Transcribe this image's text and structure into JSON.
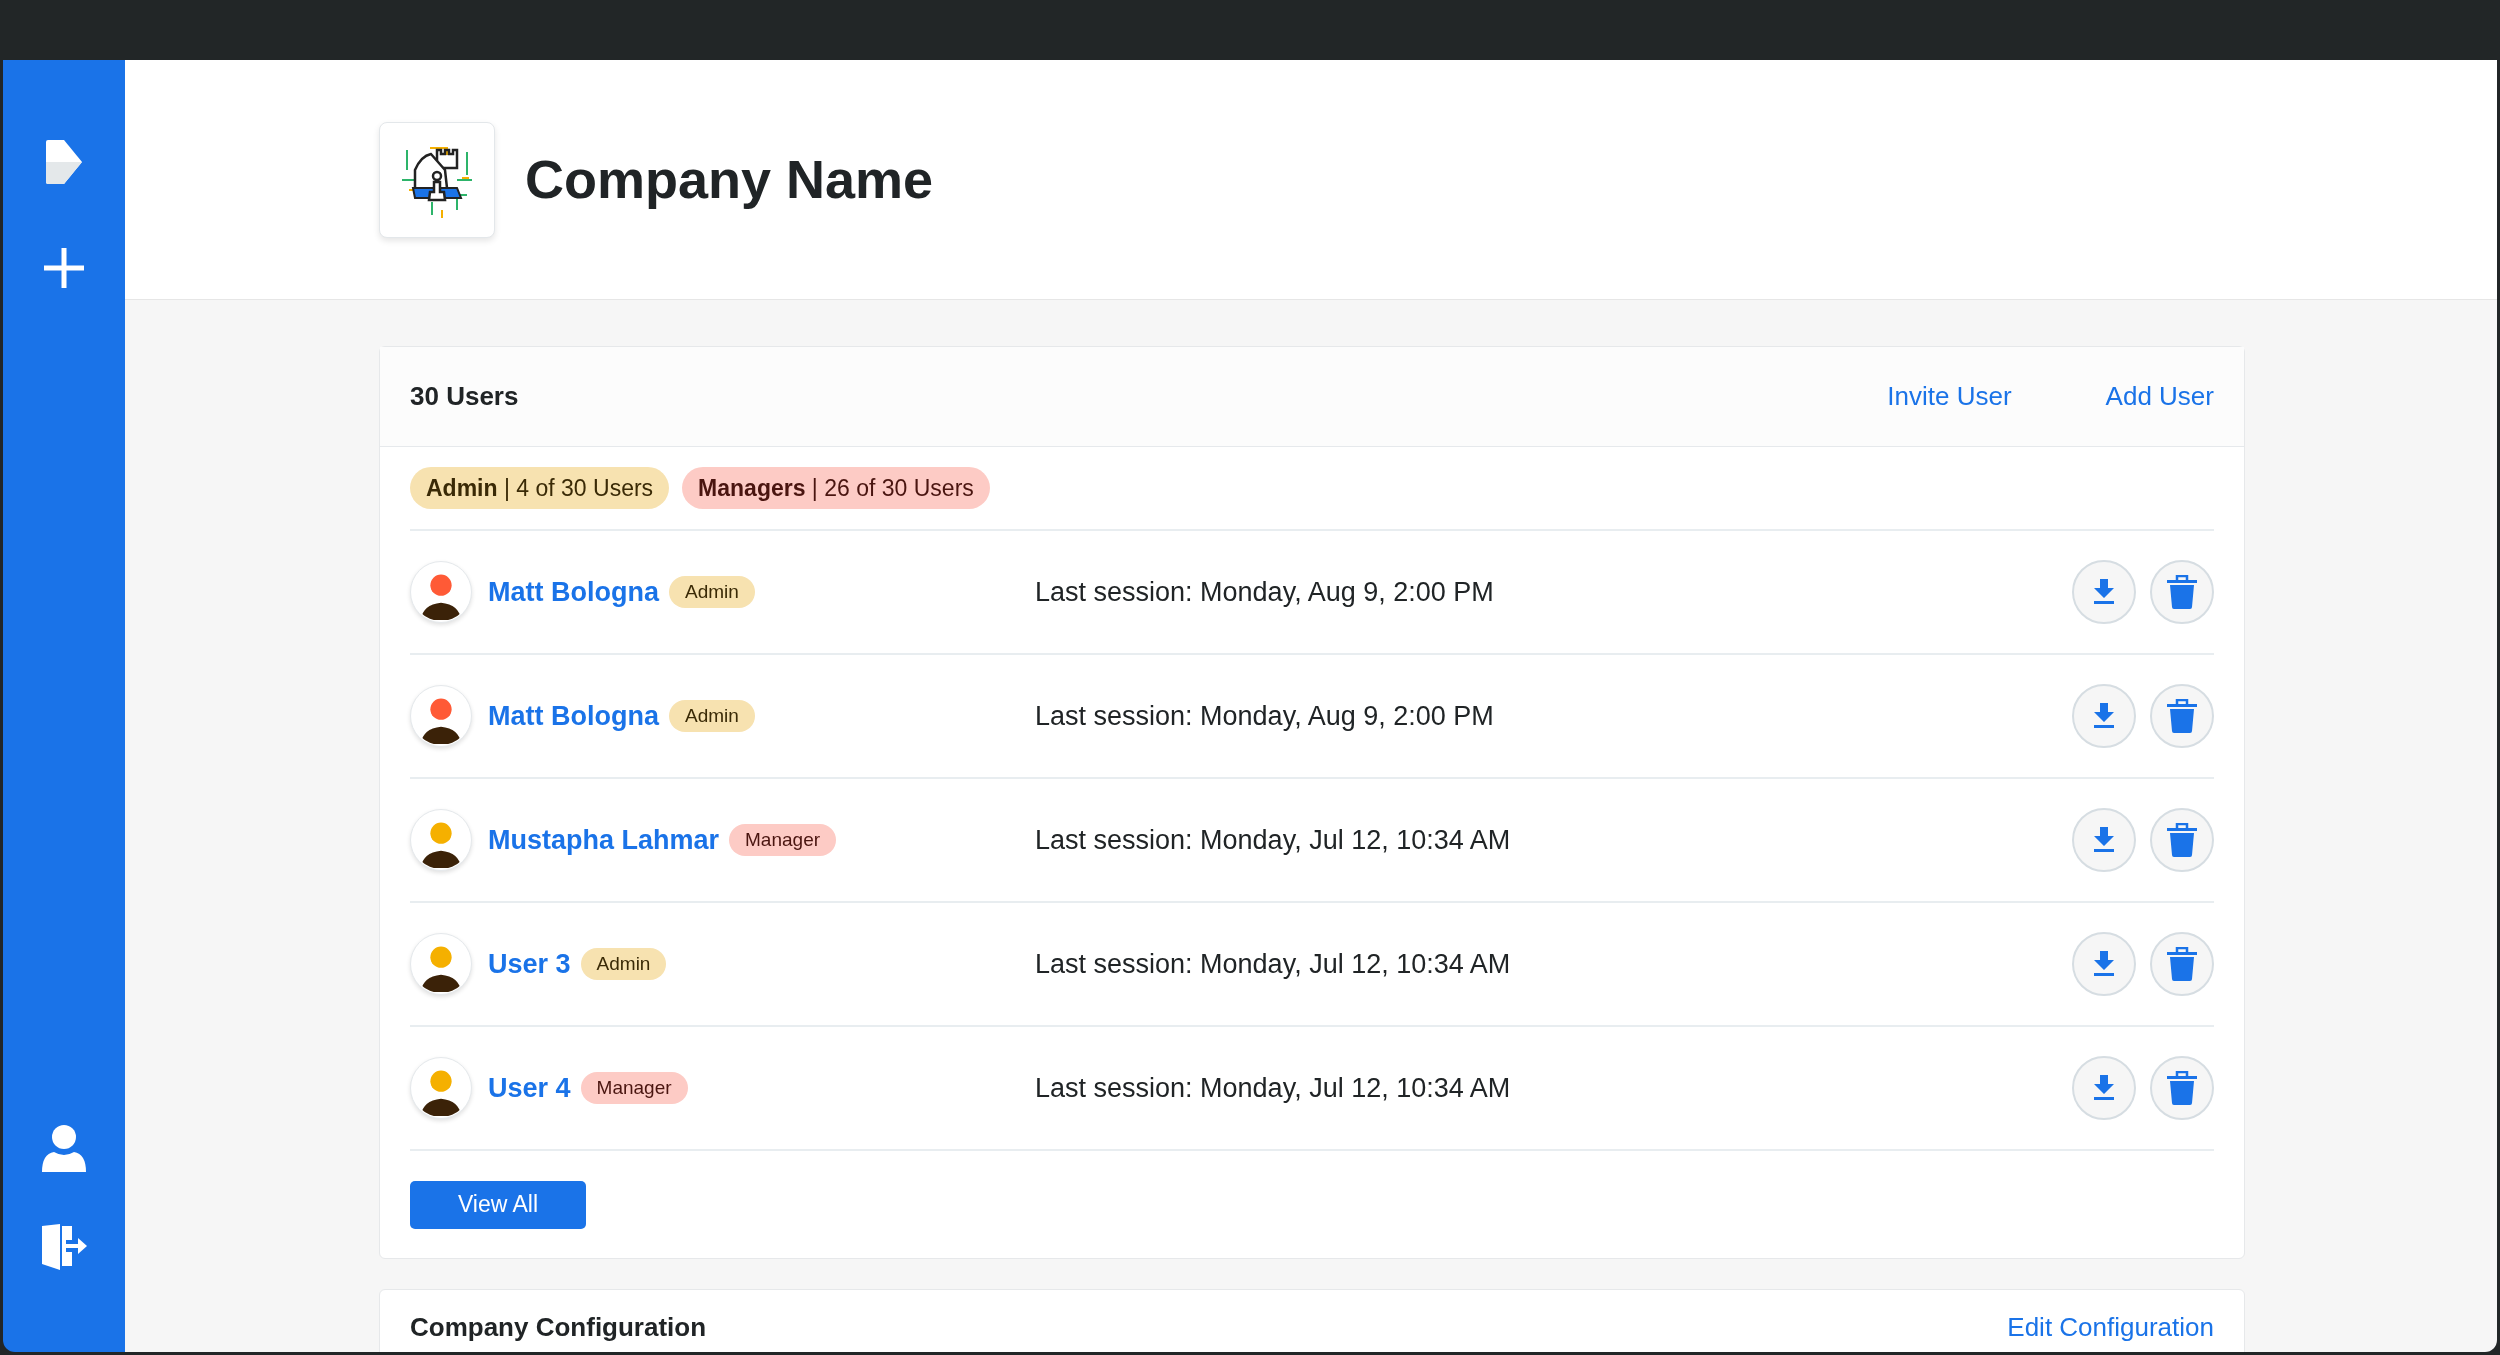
{
  "header": {
    "title": "Company Name"
  },
  "users_card": {
    "title": "30 Users",
    "actions": [
      "Invite User",
      "Add User"
    ],
    "summary": [
      {
        "kind": "admin",
        "text": "**Admin** | 4 of 30 Users"
      },
      {
        "kind": "manager",
        "text": "**Managers** | 26 of 30 Users"
      }
    ],
    "users": [
      {
        "name": "Matt Bologna",
        "role": "Admin",
        "kind": "admin",
        "color": "#ff5a36",
        "session": "Last session: Monday, Aug 9, 2:00 PM"
      },
      {
        "name": "Matt Bologna",
        "role": "Admin",
        "kind": "admin",
        "color": "#ff5a36",
        "session": "Last session: Monday, Aug 9, 2:00 PM"
      },
      {
        "name": "Mustapha Lahmar",
        "role": "Manager",
        "kind": "manager",
        "color": "#f5b000",
        "session": "Last session: Monday, Jul 12, 10:34 AM"
      },
      {
        "name": "User 3",
        "role": "Admin",
        "kind": "admin",
        "color": "#f5b000",
        "session": "Last session: Monday, Jul 12, 10:34 AM"
      },
      {
        "name": "User 4",
        "role": "Manager",
        "kind": "manager",
        "color": "#f5b000",
        "session": "Last session: Monday, Jul 12, 10:34 AM"
      }
    ],
    "view_all": "View All"
  },
  "config_card": {
    "title": "Company Configuration",
    "action": "Edit Configuration"
  }
}
